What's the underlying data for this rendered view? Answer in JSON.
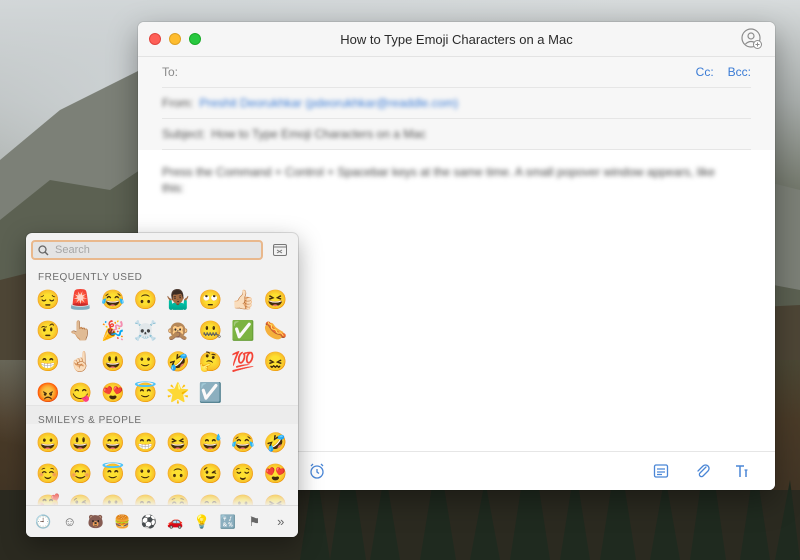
{
  "window": {
    "title": "How to Type Emoji Characters on a Mac"
  },
  "headers": {
    "to_label": "To:",
    "cc_label": "Cc:",
    "bcc_label": "Bcc:",
    "from_label": "From:",
    "from_value": "Preshit Deorukhkar (pdeorukhkar@readdle.com)",
    "subject_label": "Subject:",
    "subject_value": "How to Type Emoji Characters on a Mac"
  },
  "body": {
    "text": "Press the Command + Control + Spacebar keys at the same time. A small popover window appears, like this:"
  },
  "picker": {
    "search_placeholder": "Search",
    "section_frequent": "FREQUENTLY USED",
    "section_smileys": "SMILEYS & PEOPLE",
    "frequent": [
      "😔",
      "🚨",
      "😂",
      "🙃",
      "🤷🏾‍♂️",
      "🙄",
      "👍🏻",
      "😆",
      "🤨",
      "👆🏼",
      "🎉",
      "☠️",
      "🙊",
      "🤐",
      "✅",
      "🌭",
      "😁",
      "☝🏻",
      "😃",
      "🙂",
      "🤣",
      "🤔",
      "💯",
      "😖",
      "😡",
      "😋",
      "😍",
      "😇",
      "🌟",
      "☑️"
    ],
    "smileys": [
      "😀",
      "😃",
      "😄",
      "😁",
      "😆",
      "😅",
      "😂",
      "🤣",
      "☺️",
      "😊",
      "😇",
      "🙂",
      "🙃",
      "😉",
      "😌",
      "😍",
      "🥰",
      "😘",
      "😗",
      "😙",
      "😚",
      "😋",
      "😛",
      "😝"
    ],
    "categories": [
      {
        "name": "recent",
        "glyph": "🕘"
      },
      {
        "name": "smileys",
        "glyph": "☺"
      },
      {
        "name": "animals",
        "glyph": "🐻"
      },
      {
        "name": "food",
        "glyph": "🍔"
      },
      {
        "name": "activity",
        "glyph": "⚽"
      },
      {
        "name": "travel",
        "glyph": "🚗"
      },
      {
        "name": "objects",
        "glyph": "💡"
      },
      {
        "name": "symbols",
        "glyph": "🔣"
      },
      {
        "name": "flags",
        "glyph": "⚑"
      },
      {
        "name": "more",
        "glyph": "»"
      }
    ]
  },
  "colors": {
    "accent": "#3a7bd5",
    "search_focus": "#e9b88c",
    "active_category": "#e8862a"
  }
}
